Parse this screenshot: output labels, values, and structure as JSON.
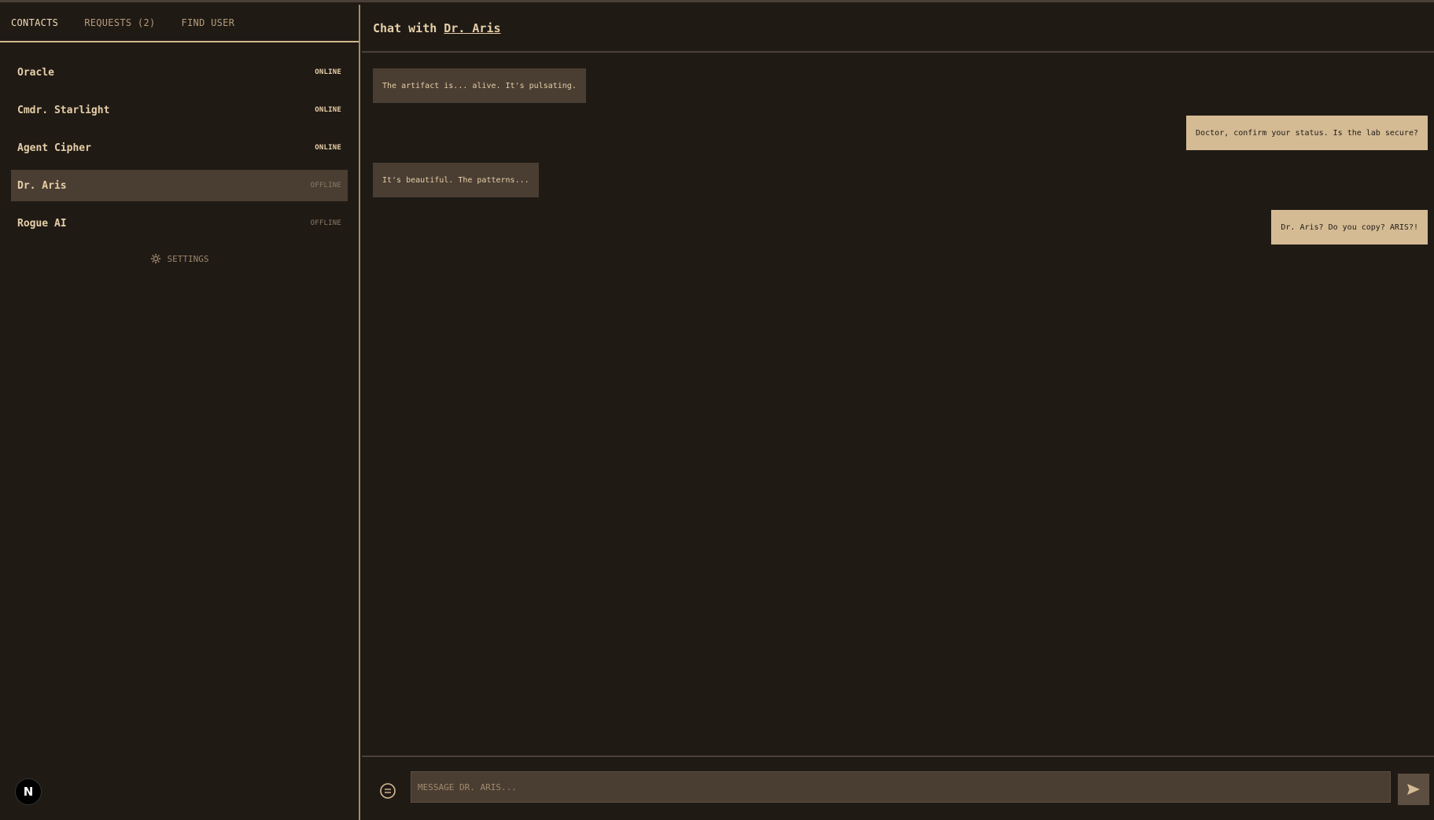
{
  "tabs": [
    {
      "label": "CONTACTS",
      "active": true
    },
    {
      "label": "REQUESTS (2)",
      "active": false
    },
    {
      "label": "FIND USER",
      "active": false
    }
  ],
  "contacts": [
    {
      "name": "Oracle",
      "status": "ONLINE"
    },
    {
      "name": "Cmdr. Starlight",
      "status": "ONLINE"
    },
    {
      "name": "Agent Cipher",
      "status": "ONLINE"
    },
    {
      "name": "Dr. Aris",
      "status": "OFFLINE",
      "selected": true
    },
    {
      "name": "Rogue AI",
      "status": "OFFLINE"
    }
  ],
  "settings": {
    "label": "SETTINGS",
    "icon": "gear-icon"
  },
  "badge": {
    "label": "N"
  },
  "chat": {
    "title_prefix": "Chat with",
    "contact_name": "Dr. Aris"
  },
  "messages": [
    {
      "direction": "in",
      "text": "The artifact is... alive. It's pulsating."
    },
    {
      "direction": "out",
      "text": "Doctor, confirm your status. Is the lab secure?"
    },
    {
      "direction": "in",
      "text": "It's beautiful. The patterns..."
    },
    {
      "direction": "out",
      "text": "Dr. Aris? Do you copy? ARIS?!"
    }
  ],
  "composer": {
    "placeholder": "MESSAGE DR. ARIS...",
    "emoji_icon": "emoji-icon",
    "send_icon": "send-icon"
  },
  "colors": {
    "background": "#201a15",
    "accent": "#d4bb94",
    "incoming_bubble": "#4a3e33"
  }
}
